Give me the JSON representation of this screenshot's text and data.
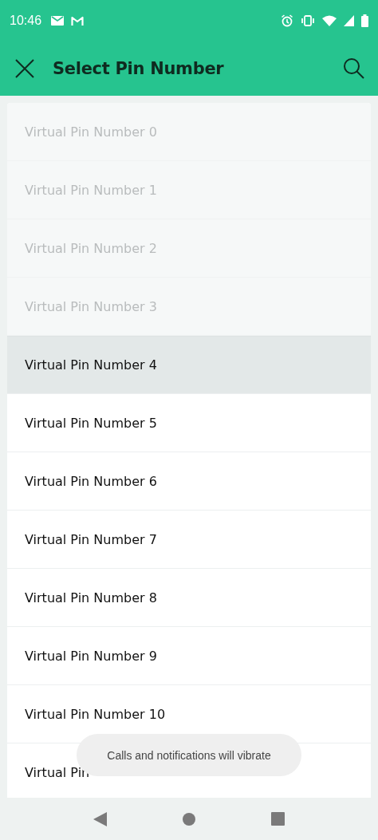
{
  "status_bar": {
    "time": "10:46"
  },
  "app_bar": {
    "title": "Select Pin Number"
  },
  "pins": [
    {
      "label": "Virtual Pin Number 0",
      "disabled": true,
      "selected": false
    },
    {
      "label": "Virtual Pin Number 1",
      "disabled": true,
      "selected": false
    },
    {
      "label": "Virtual Pin Number 2",
      "disabled": true,
      "selected": false
    },
    {
      "label": "Virtual Pin Number 3",
      "disabled": true,
      "selected": false
    },
    {
      "label": "Virtual Pin Number 4",
      "disabled": false,
      "selected": true
    },
    {
      "label": "Virtual Pin Number 5",
      "disabled": false,
      "selected": false
    },
    {
      "label": "Virtual Pin Number 6",
      "disabled": false,
      "selected": false
    },
    {
      "label": "Virtual Pin Number 7",
      "disabled": false,
      "selected": false
    },
    {
      "label": "Virtual Pin Number 8",
      "disabled": false,
      "selected": false
    },
    {
      "label": "Virtual Pin Number 9",
      "disabled": false,
      "selected": false
    },
    {
      "label": "Virtual Pin Number 10",
      "disabled": false,
      "selected": false
    },
    {
      "label": "Virtual Pin",
      "disabled": false,
      "selected": false
    }
  ],
  "toast": {
    "message": "Calls and notifications will vibrate"
  }
}
